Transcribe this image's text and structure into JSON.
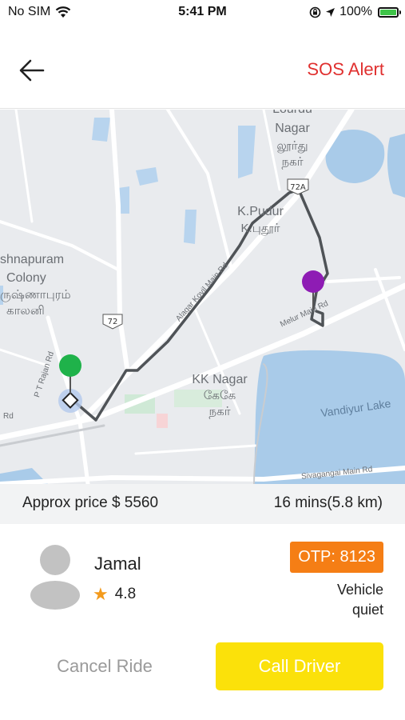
{
  "status_bar": {
    "carrier": "No SIM",
    "time": "5:41 PM",
    "battery": "100%",
    "battery_level": 1.0,
    "icons": [
      "wifi-icon",
      "orientation-lock-icon",
      "location-arrow-icon",
      "battery-charging-icon"
    ]
  },
  "header": {
    "back_icon": "arrow-left-icon",
    "sos_label": "SOS Alert",
    "sos_color": "#e0302f"
  },
  "map": {
    "labels": {
      "lourdu_nagar": "Lourdu",
      "nagar": "Nagar",
      "nagar_tamil": "லூர்து",
      "nagar_tamil2": "நகர்",
      "route_72a": "72A",
      "kpudur": "K.Pudur",
      "kpudur_tamil": "K.புதூர்",
      "krishnapuram": "shnapuram",
      "colony": "Colony",
      "krishnapuram_tamil": "ருஷ்ணாபுரம்",
      "colony_tamil": "காலனி",
      "route_72": "72",
      "alagar_road": "Alagar Kovil Main Rd",
      "melur_road": "Melur Main Rd",
      "pt_rajan": "P T Rajan Rd",
      "rd": "Rd",
      "kk_nagar": "KK Nagar",
      "kk_nagar_tamil": "கேகே",
      "kk_nagar_tamil2": "நகர்",
      "vandiyur_lake": "Vandiyur Lake",
      "sivagangai_road": "Sivagangai Main Rd"
    },
    "colors": {
      "land": "#e9ebee",
      "water": "#a9cbe9",
      "road": "#ffffff",
      "route": "#4f5357",
      "pickup_pin": "#1fb24a",
      "drop_pin": "#8e1cb4"
    }
  },
  "trip": {
    "price_label": "Approx price $ 5560",
    "eta_label": "16 mins(5.8 km)"
  },
  "driver": {
    "name": "Jamal",
    "rating": "4.8",
    "otp": "OTP: 8123",
    "vehicle_line1": "Vehicle",
    "vehicle_line2": "quiet",
    "otp_color": "#f57e15"
  },
  "actions": {
    "cancel_label": "Cancel Ride",
    "call_label": "Call Driver",
    "call_color": "#fbe10a"
  }
}
